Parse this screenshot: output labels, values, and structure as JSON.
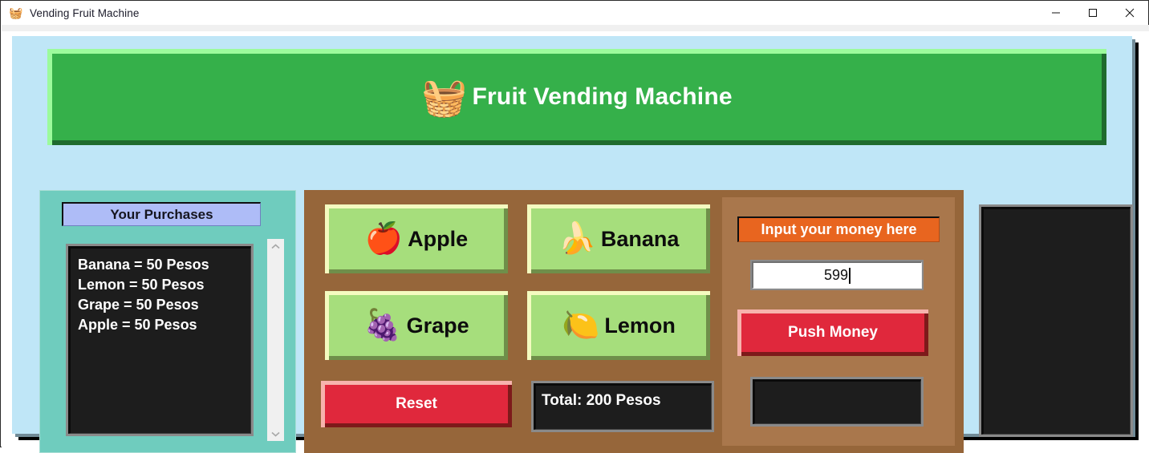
{
  "window": {
    "title": "Vending Fruit Machine",
    "icon": "basket-icon",
    "minimize_label": "Minimize",
    "maximize_label": "Maximize",
    "close_label": "Close"
  },
  "header": {
    "icon": "🧺",
    "title": "Fruit Vending Machine",
    "background": "#35b04a"
  },
  "purchases": {
    "label": "Your Purchases",
    "items": [
      "Banana = 50 Pesos",
      "Lemon = 50 Pesos",
      "Grape = 50 Pesos",
      "Apple = 50 Pesos"
    ],
    "scroll_up": "^",
    "scroll_down": "v",
    "panel_color": "#6fccbe",
    "label_color": "#aebcf7"
  },
  "fruits": [
    {
      "name": "Apple",
      "icon": "🍎"
    },
    {
      "name": "Banana",
      "icon": "🍌"
    },
    {
      "name": "Grape",
      "icon": "🍇"
    },
    {
      "name": "Lemon",
      "icon": "🍋"
    }
  ],
  "controls": {
    "reset_label": "Reset",
    "total_text": "Total: 200 Pesos",
    "reset_color": "#e0283c"
  },
  "money": {
    "label": "Input your money here",
    "label_color": "#e8651f",
    "input_value": "599",
    "input_placeholder": "",
    "push_label": "Push Money",
    "change_text": ""
  },
  "dispenser": {
    "content": ""
  }
}
